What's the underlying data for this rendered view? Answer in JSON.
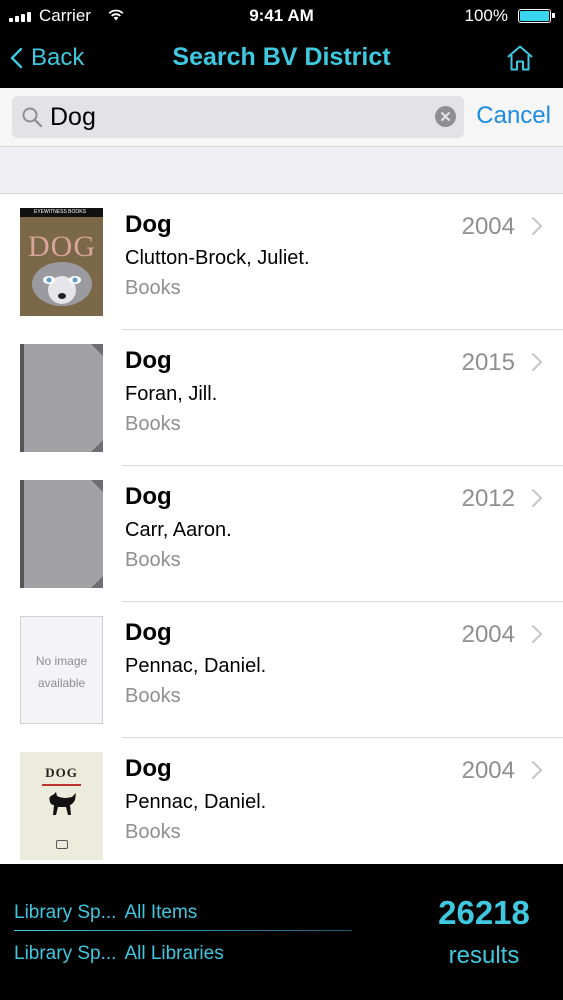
{
  "status_bar": {
    "carrier": "Carrier",
    "time": "9:41 AM",
    "battery": "100%",
    "battery_level": 1.0
  },
  "nav": {
    "back_label": "Back",
    "title": "Search BV District",
    "home_icon": "home-icon"
  },
  "search": {
    "value": "Dog",
    "cancel_label": "Cancel"
  },
  "results": [
    {
      "title": "Dog",
      "author": "Clutton-Brock, Juliet.",
      "type": "Books",
      "year": "2004",
      "cover": "eyewitness-cover",
      "cover_text": "DOG",
      "cover_brand": "EYEWITNESS BOOKS"
    },
    {
      "title": "Dog",
      "author": "Foran, Jill.",
      "type": "Books",
      "year": "2015",
      "cover": "generic-grey-cover"
    },
    {
      "title": "Dog",
      "author": "Carr, Aaron.",
      "type": "Books",
      "year": "2012",
      "cover": "generic-grey-cover"
    },
    {
      "title": "Dog",
      "author": "Pennac, Daniel.",
      "type": "Books",
      "year": "2004",
      "cover": "no-image",
      "cover_line1": "No image",
      "cover_line2": "available"
    },
    {
      "title": "Dog",
      "author": "Pennac, Daniel.",
      "type": "Books",
      "year": "2004",
      "cover": "dog-illustrated-cover",
      "cover_text": "DOG"
    }
  ],
  "footer": {
    "filter1_key": "Library Sp...",
    "filter1_value": "All Items",
    "filter2_key": "Library Sp...",
    "filter2_value": "All Libraries",
    "count": "26218",
    "count_label": "results"
  },
  "colors": {
    "accent": "#3fc8e0",
    "link": "#1d8ce0",
    "bar_bg": "#000000"
  }
}
